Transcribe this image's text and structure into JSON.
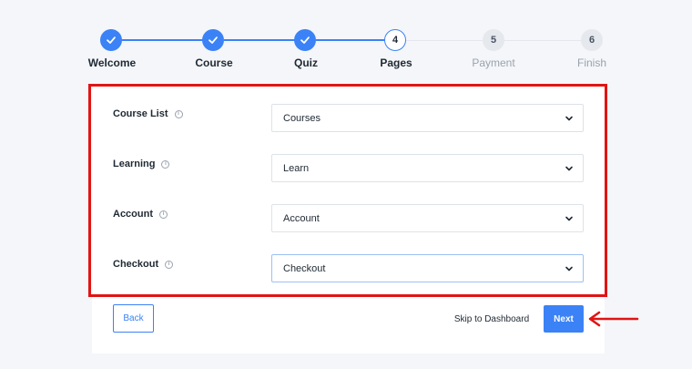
{
  "stepper": {
    "steps": [
      {
        "number": "1",
        "label": "Welcome",
        "state": "done"
      },
      {
        "number": "2",
        "label": "Course",
        "state": "done"
      },
      {
        "number": "3",
        "label": "Quiz",
        "state": "done"
      },
      {
        "number": "4",
        "label": "Pages",
        "state": "current"
      },
      {
        "number": "5",
        "label": "Payment",
        "state": "pending"
      },
      {
        "number": "6",
        "label": "Finish",
        "state": "pending"
      }
    ]
  },
  "form": {
    "rows": [
      {
        "label": "Course List",
        "value": "Courses"
      },
      {
        "label": "Learning",
        "value": "Learn"
      },
      {
        "label": "Account",
        "value": "Account"
      },
      {
        "label": "Checkout",
        "value": "Checkout"
      }
    ]
  },
  "footer": {
    "back_label": "Back",
    "skip_label": "Skip to Dashboard",
    "next_label": "Next"
  },
  "colors": {
    "accent": "#3b82f6",
    "annotation": "#e11414",
    "background": "#f4f6f9"
  }
}
